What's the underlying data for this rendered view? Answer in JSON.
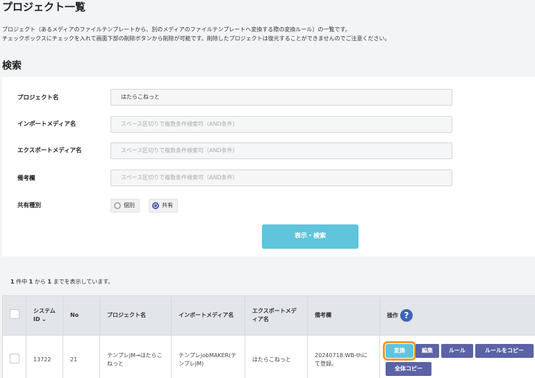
{
  "page": {
    "title": "プロジェクト一覧",
    "desc_line1": "プロジェクト（あるメディアのファイルテンプレートから、別のメディアのファイルテンプレートへ変換する際の変換ルール）の一覧です。",
    "desc_line2": "チェックボックスにチェックを入れて画面下部の削除ボタンから削除が可能です。削除したプロジェクトは復元することができませんのでご注意ください。"
  },
  "search": {
    "section_title": "検索",
    "fields": {
      "project_name": {
        "label": "プロジェクト名",
        "value": "はたらこねっと"
      },
      "import_media": {
        "label": "インポートメディア名",
        "placeholder": "スペース区切りで複数条件検索可（AND条件）"
      },
      "export_media": {
        "label": "エクスポートメディア名",
        "placeholder": "スペース区切りで複数条件検索可（AND条件）"
      },
      "remarks": {
        "label": "備考欄",
        "placeholder": "スペース区切りで複数条件検索可（AND条件）"
      }
    },
    "share_type": {
      "label": "共有種別",
      "options": [
        {
          "label": "個別",
          "checked": false
        },
        {
          "label": "共有",
          "checked": true
        }
      ]
    },
    "submit_label": "表示・検索"
  },
  "results": {
    "count_pre": "件中",
    "count_mid": "から",
    "count_post": "までを表示しています。",
    "total": "1",
    "from": "1",
    "to": "1",
    "headers": {
      "system_id": "システムID",
      "no": "No",
      "project_name": "プロジェクト名",
      "import_media": "インポートメディア名",
      "export_media": "エクスポートメディア名",
      "remarks": "備考欄",
      "actions": "操作"
    },
    "rows": [
      {
        "system_id": "13722",
        "no": "21",
        "project_name": "テンプレJM→はたらこねっと",
        "import_media": "テンプレjobMAKER(テンプレJM)",
        "export_media": "はたらこねっと",
        "remarks": "20240718:WB-thにて登録。"
      }
    ],
    "actions": {
      "convert": "変換",
      "edit": "編集",
      "rule": "ルール",
      "copy_rule": "ルールをコピー",
      "copy_all": "全体コピー"
    }
  },
  "colors": {
    "accent_cyan": "#5fc4dc",
    "action_purple": "#5b62a6",
    "highlight_orange": "#f59a23",
    "help_blue": "#3f62b8"
  },
  "icons": {
    "sort": "chevron-down-icon",
    "help": "question-circle-icon"
  }
}
